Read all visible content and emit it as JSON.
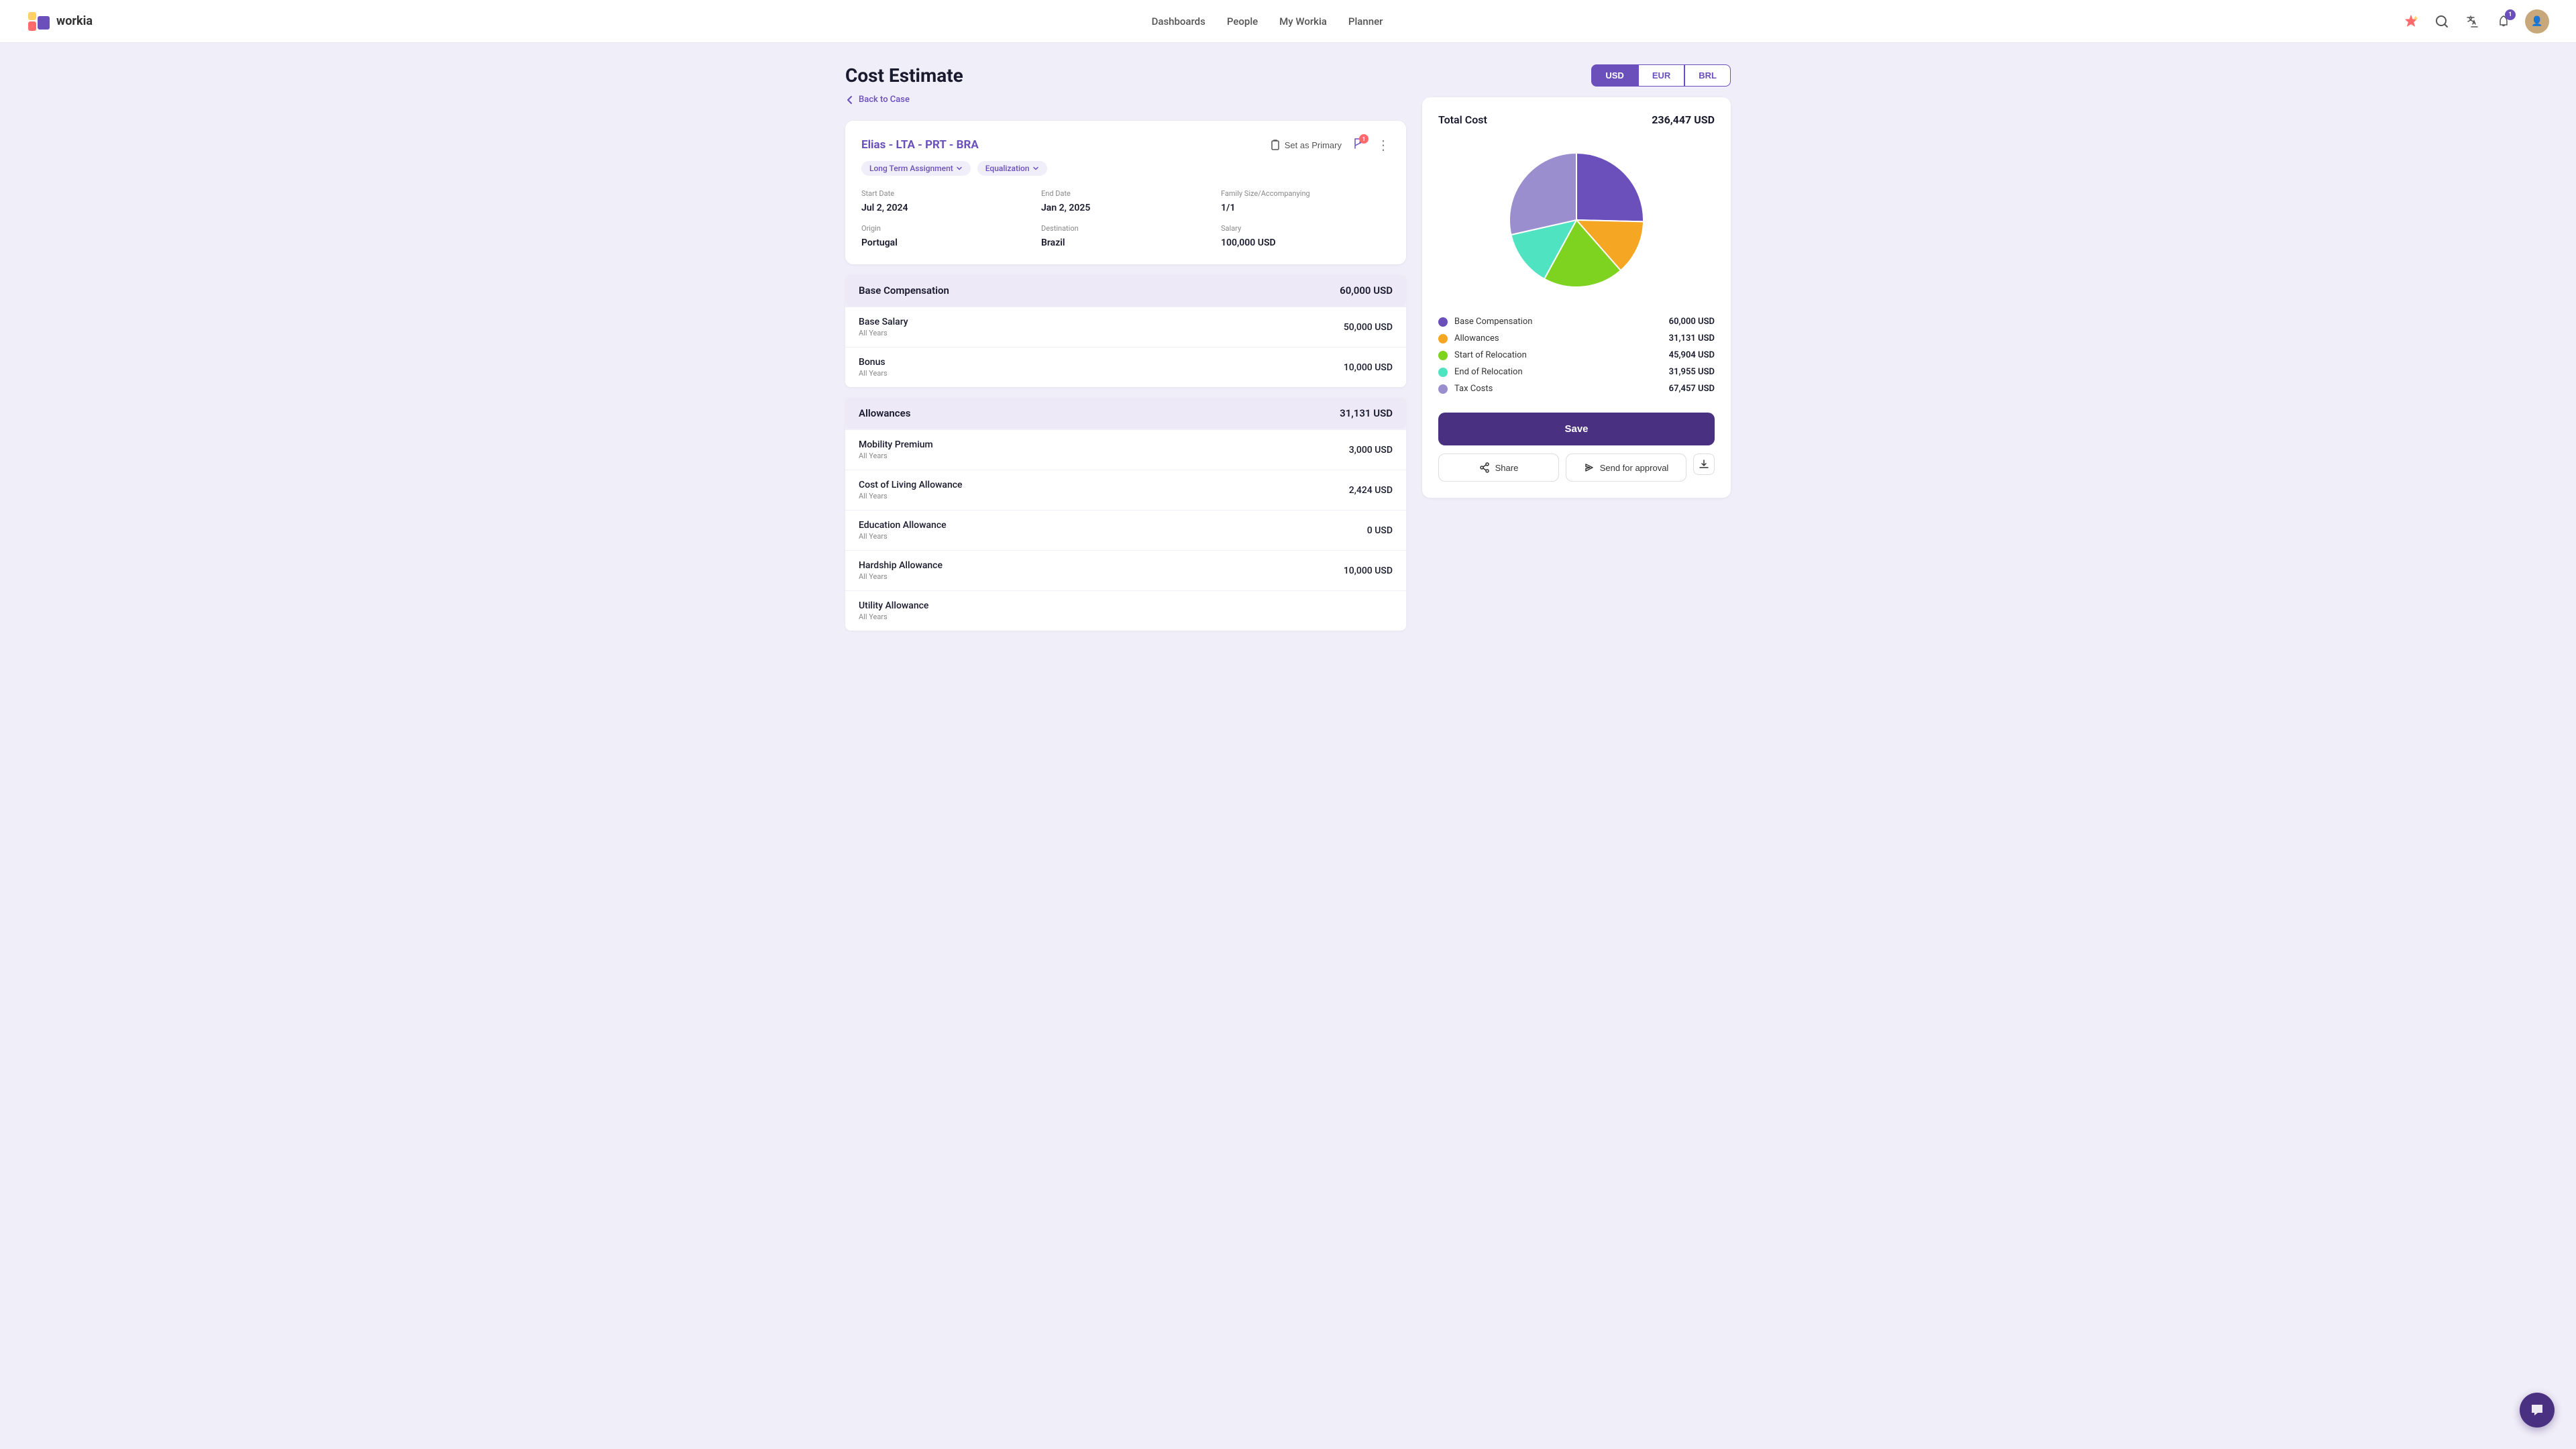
{
  "brand": {
    "name": "workia"
  },
  "nav": {
    "links": [
      "Dashboards",
      "People",
      "My Workia",
      "Planner"
    ]
  },
  "header": {
    "notification_count": "1",
    "ai_icon": "✦",
    "search_icon": "🔍",
    "translate_icon": "🌐"
  },
  "page": {
    "title": "Cost Estimate",
    "back_label": "Back to Case"
  },
  "case": {
    "title": "Elias - LTA - PRT - BRA",
    "set_primary": "Set as Primary",
    "badge_assignment": "Long Term Assignment",
    "badge_equalization": "Equalization",
    "start_date_label": "Start Date",
    "start_date": "Jul 2, 2024",
    "end_date_label": "End Date",
    "end_date": "Jan 2, 2025",
    "family_label": "Family Size/Accompanying",
    "family": "1/1",
    "origin_label": "Origin",
    "origin": "Portugal",
    "destination_label": "Destination",
    "destination": "Brazil",
    "salary_label": "Salary",
    "salary": "100,000 USD"
  },
  "sections": [
    {
      "id": "base_compensation",
      "title": "Base Compensation",
      "total": "60,000 USD",
      "items": [
        {
          "name": "Base Salary",
          "period": "All Years",
          "amount": "50,000 USD"
        },
        {
          "name": "Bonus",
          "period": "All Years",
          "amount": "10,000 USD"
        }
      ]
    },
    {
      "id": "allowances",
      "title": "Allowances",
      "total": "31,131 USD",
      "items": [
        {
          "name": "Mobility Premium",
          "period": "All Years",
          "amount": "3,000 USD"
        },
        {
          "name": "Cost of Living Allowance",
          "period": "All Years",
          "amount": "2,424 USD"
        },
        {
          "name": "Education Allowance",
          "period": "All Years",
          "amount": "0 USD"
        },
        {
          "name": "Hardship Allowance",
          "period": "All Years",
          "amount": "10,000 USD"
        },
        {
          "name": "Utility Allowance",
          "period": "All Years",
          "amount": ""
        }
      ]
    }
  ],
  "currency": {
    "options": [
      "USD",
      "EUR",
      "BRL"
    ],
    "active": "USD"
  },
  "cost_summary": {
    "label": "Total Cost",
    "value": "236,447 USD",
    "legend": [
      {
        "label": "Base Compensation",
        "value": "60,000 USD",
        "color": "#6b4fbb"
      },
      {
        "label": "Allowances",
        "value": "31,131 USD",
        "color": "#f5a623"
      },
      {
        "label": "Start of Relocation",
        "value": "45,904 USD",
        "color": "#7ed321"
      },
      {
        "label": "End of Relocation",
        "value": "31,955 USD",
        "color": "#50e3c2"
      },
      {
        "label": "Tax Costs",
        "value": "67,457 USD",
        "color": "#9b8ecf"
      }
    ]
  },
  "actions": {
    "save_label": "Save",
    "share_label": "Share",
    "approval_label": "Send for approval",
    "download_icon": "⬇"
  },
  "chart": {
    "segments": [
      {
        "label": "Base Compensation",
        "color": "#6b4fbb",
        "value": 60000,
        "percent": 25.4
      },
      {
        "label": "Allowances",
        "color": "#f5a623",
        "value": 31131,
        "percent": 13.2
      },
      {
        "label": "Start of Relocation",
        "color": "#7ed321",
        "value": 45904,
        "percent": 19.4
      },
      {
        "label": "End of Relocation",
        "color": "#50e3c2",
        "value": 31955,
        "percent": 13.5
      },
      {
        "label": "Tax Costs",
        "color": "#9b8ecf",
        "value": 67457,
        "percent": 28.5
      }
    ]
  }
}
